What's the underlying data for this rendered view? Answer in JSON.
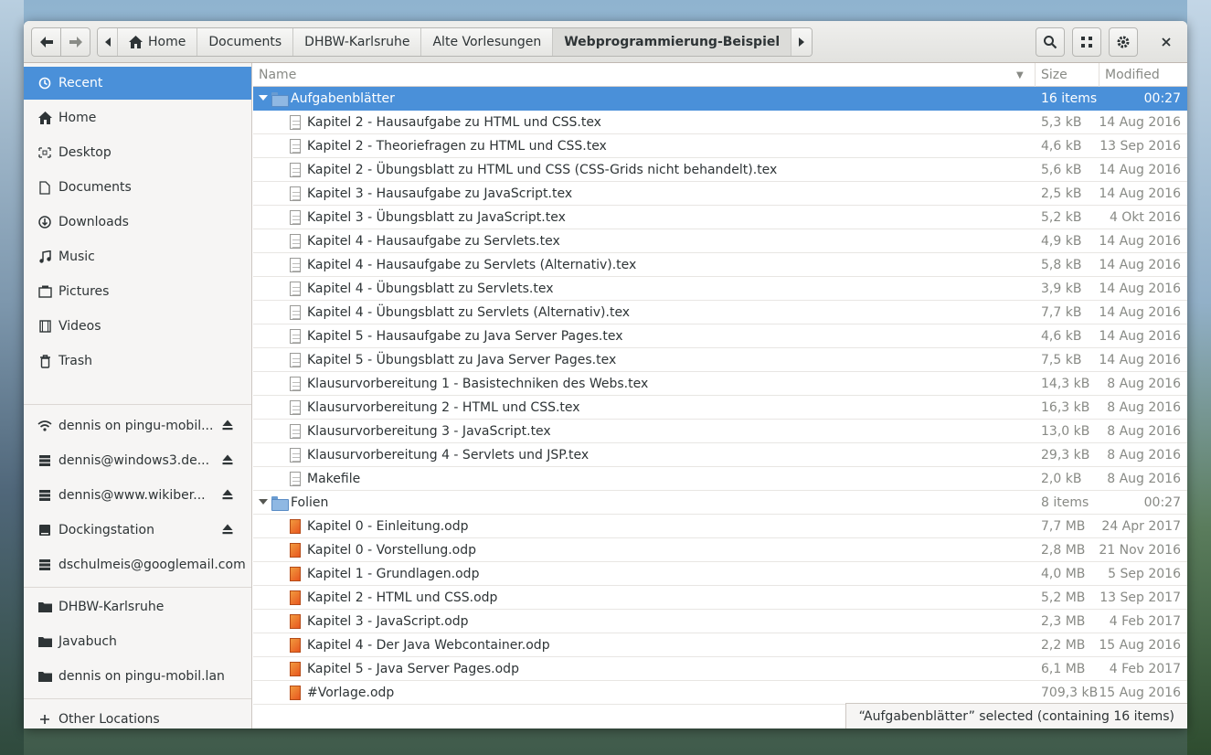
{
  "toolbar": {
    "back_label": "back",
    "forward_label": "forward",
    "search_icon": "search-icon",
    "view_icon": "grid-view-icon",
    "menu_icon": "gear-icon",
    "close_icon": "close-icon"
  },
  "breadcrumb": [
    {
      "label": "Home",
      "icon": "home-icon"
    },
    {
      "label": "Documents"
    },
    {
      "label": "DHBW-Karlsruhe"
    },
    {
      "label": "Alte Vorlesungen"
    },
    {
      "label": "Webprogrammierung-Beispiel",
      "current": true
    }
  ],
  "sidebar": {
    "places": [
      {
        "label": "Recent",
        "icon": "recent-icon",
        "active": true
      },
      {
        "label": "Home",
        "icon": "home-icon"
      },
      {
        "label": "Desktop",
        "icon": "desktop-icon"
      },
      {
        "label": "Documents",
        "icon": "document-icon"
      },
      {
        "label": "Downloads",
        "icon": "download-icon"
      },
      {
        "label": "Music",
        "icon": "music-icon"
      },
      {
        "label": "Pictures",
        "icon": "picture-icon"
      },
      {
        "label": "Videos",
        "icon": "video-icon"
      },
      {
        "label": "Trash",
        "icon": "trash-icon"
      }
    ],
    "mounts": [
      {
        "label": "dennis on pingu-mobil...",
        "icon": "network-icon",
        "eject": true
      },
      {
        "label": "dennis@windows3.de...",
        "icon": "server-icon",
        "eject": true
      },
      {
        "label": "dennis@www.wikiber...",
        "icon": "server-icon",
        "eject": true
      },
      {
        "label": "Dockingstation",
        "icon": "drive-icon",
        "eject": true
      },
      {
        "label": "dschulmeis@googlemail.com",
        "icon": "server-icon",
        "eject": false
      }
    ],
    "bookmarks": [
      {
        "label": "DHBW-Karlsruhe",
        "icon": "folder-icon"
      },
      {
        "label": "Javabuch",
        "icon": "folder-icon"
      },
      {
        "label": "dennis on pingu-mobil.lan",
        "icon": "folder-icon"
      }
    ],
    "other": {
      "label": "Other Locations",
      "icon": "plus-icon"
    }
  },
  "columns": {
    "name": "Name",
    "size": "Size",
    "modified": "Modified"
  },
  "rows": [
    {
      "type": "folder",
      "name": "Aufgabenblätter",
      "size": "16 items",
      "modified": "00:27",
      "selected": true,
      "level": 0
    },
    {
      "type": "tex",
      "name": "Kapitel 2 - Hausaufgabe zu HTML und CSS.tex",
      "size": "5,3 kB",
      "modified": "14 Aug 2016",
      "level": 1
    },
    {
      "type": "tex",
      "name": "Kapitel 2 - Theoriefragen zu HTML und CSS.tex",
      "size": "4,6 kB",
      "modified": "13 Sep 2016",
      "level": 1
    },
    {
      "type": "tex",
      "name": "Kapitel 2 - Übungsblatt zu HTML und CSS (CSS-Grids nicht behandelt).tex",
      "size": "5,6 kB",
      "modified": "14 Aug 2016",
      "level": 1
    },
    {
      "type": "tex",
      "name": "Kapitel 3 - Hausaufgabe zu JavaScript.tex",
      "size": "2,5 kB",
      "modified": "14 Aug 2016",
      "level": 1
    },
    {
      "type": "tex",
      "name": "Kapitel 3 - Übungsblatt zu JavaScript.tex",
      "size": "5,2 kB",
      "modified": "4 Okt 2016",
      "level": 1
    },
    {
      "type": "tex",
      "name": "Kapitel 4 - Hausaufgabe zu Servlets.tex",
      "size": "4,9 kB",
      "modified": "14 Aug 2016",
      "level": 1
    },
    {
      "type": "tex",
      "name": "Kapitel 4 - Hausaufgabe zu Servlets (Alternativ).tex",
      "size": "5,8 kB",
      "modified": "14 Aug 2016",
      "level": 1
    },
    {
      "type": "tex",
      "name": "Kapitel 4 - Übungsblatt zu Servlets.tex",
      "size": "3,9 kB",
      "modified": "14 Aug 2016",
      "level": 1
    },
    {
      "type": "tex",
      "name": "Kapitel 4 - Übungsblatt zu Servlets (Alternativ).tex",
      "size": "7,7 kB",
      "modified": "14 Aug 2016",
      "level": 1
    },
    {
      "type": "tex",
      "name": "Kapitel 5 - Hausaufgabe zu Java Server Pages.tex",
      "size": "4,6 kB",
      "modified": "14 Aug 2016",
      "level": 1
    },
    {
      "type": "tex",
      "name": "Kapitel 5 - Übungsblatt zu Java Server Pages.tex",
      "size": "7,5 kB",
      "modified": "14 Aug 2016",
      "level": 1
    },
    {
      "type": "tex",
      "name": "Klausurvorbereitung 1 - Basistechniken des Webs.tex",
      "size": "14,3 kB",
      "modified": "8 Aug 2016",
      "level": 1
    },
    {
      "type": "tex",
      "name": "Klausurvorbereitung 2 - HTML und CSS.tex",
      "size": "16,3 kB",
      "modified": "8 Aug 2016",
      "level": 1
    },
    {
      "type": "tex",
      "name": "Klausurvorbereitung 3 - JavaScript.tex",
      "size": "13,0 kB",
      "modified": "8 Aug 2016",
      "level": 1
    },
    {
      "type": "tex",
      "name": "Klausurvorbereitung 4 - Servlets und JSP.tex",
      "size": "29,3 kB",
      "modified": "8 Aug 2016",
      "level": 1
    },
    {
      "type": "tex",
      "name": "Makefile",
      "size": "2,0 kB",
      "modified": "8 Aug 2016",
      "level": 1
    },
    {
      "type": "folder",
      "name": "Folien",
      "size": "8 items",
      "modified": "00:27",
      "level": 0
    },
    {
      "type": "odp",
      "name": "Kapitel 0 - Einleitung.odp",
      "size": "7,7 MB",
      "modified": "24 Apr 2017",
      "level": 1
    },
    {
      "type": "odp",
      "name": "Kapitel 0 - Vorstellung.odp",
      "size": "2,8 MB",
      "modified": "21 Nov 2016",
      "level": 1
    },
    {
      "type": "odp",
      "name": "Kapitel 1 - Grundlagen.odp",
      "size": "4,0 MB",
      "modified": "5 Sep 2016",
      "level": 1
    },
    {
      "type": "odp",
      "name": "Kapitel 2 - HTML und CSS.odp",
      "size": "5,2 MB",
      "modified": "13 Sep 2017",
      "level": 1
    },
    {
      "type": "odp",
      "name": "Kapitel 3 - JavaScript.odp",
      "size": "2,3 MB",
      "modified": "4 Feb 2017",
      "level": 1
    },
    {
      "type": "odp",
      "name": "Kapitel 4 - Der Java Webcontainer.odp",
      "size": "2,2 MB",
      "modified": "15 Aug 2016",
      "level": 1
    },
    {
      "type": "odp",
      "name": "Kapitel 5 - Java Server Pages.odp",
      "size": "6,1 MB",
      "modified": "4 Feb 2017",
      "level": 1
    },
    {
      "type": "odp",
      "name": "#Vorlage.odp",
      "size": "709,3 kB",
      "modified": "15 Aug 2016",
      "level": 1
    }
  ],
  "status": "“Aufgabenblätter” selected  (containing 16 items)",
  "colors": {
    "accent": "#4a90d9",
    "sidebar_bg": "#f6f5f4"
  }
}
